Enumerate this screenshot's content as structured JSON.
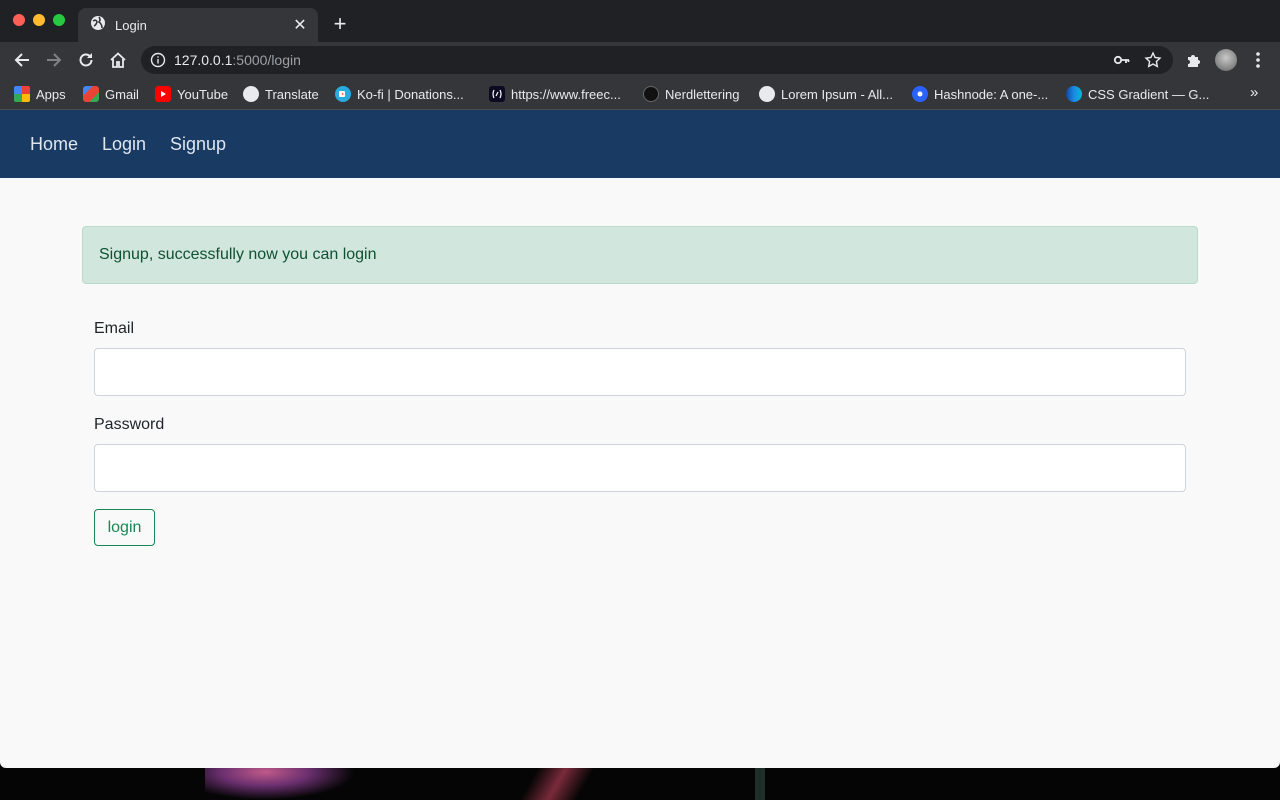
{
  "browser": {
    "tab_title": "Login",
    "url_host": "127.0.0.1",
    "url_path": ":5000/login"
  },
  "bookmarks": [
    {
      "label": "Apps",
      "icon": "apps-grid-icon",
      "color": "#ea4335"
    },
    {
      "label": "Gmail",
      "icon": "gmail-icon",
      "color": "#ea4335"
    },
    {
      "label": "YouTube",
      "icon": "youtube-icon",
      "color": "#ff0000"
    },
    {
      "label": "Translate",
      "icon": "globe-icon",
      "color": "#9aa0a6"
    },
    {
      "label": "Ko-fi | Donations...",
      "icon": "kofi-icon",
      "color": "#29abe0"
    },
    {
      "label": "https://www.freec...",
      "icon": "freecodecamp-icon",
      "color": "#0a0a23"
    },
    {
      "label": "Nerdlettering",
      "icon": "nerdlettering-icon",
      "color": "#111111"
    },
    {
      "label": "Lorem Ipsum - All...",
      "icon": "globe-icon",
      "color": "#9aa0a6"
    },
    {
      "label": "Hashnode: A one-...",
      "icon": "hashnode-icon",
      "color": "#2962ff"
    },
    {
      "label": "CSS Gradient — G...",
      "icon": "css-gradient-icon",
      "color": "#1e88e5"
    }
  ],
  "nav": {
    "home": "Home",
    "login": "Login",
    "signup": "Signup"
  },
  "alert": {
    "message": "Signup, successfully now you can login",
    "color": "#0f5132"
  },
  "form": {
    "email_label": "Email",
    "email_value": "",
    "password_label": "Password",
    "password_value": "",
    "submit_label": "login"
  },
  "colors": {
    "navbar": "#183a63",
    "success": "#198754",
    "alert_bg": "#d1e7dd"
  }
}
